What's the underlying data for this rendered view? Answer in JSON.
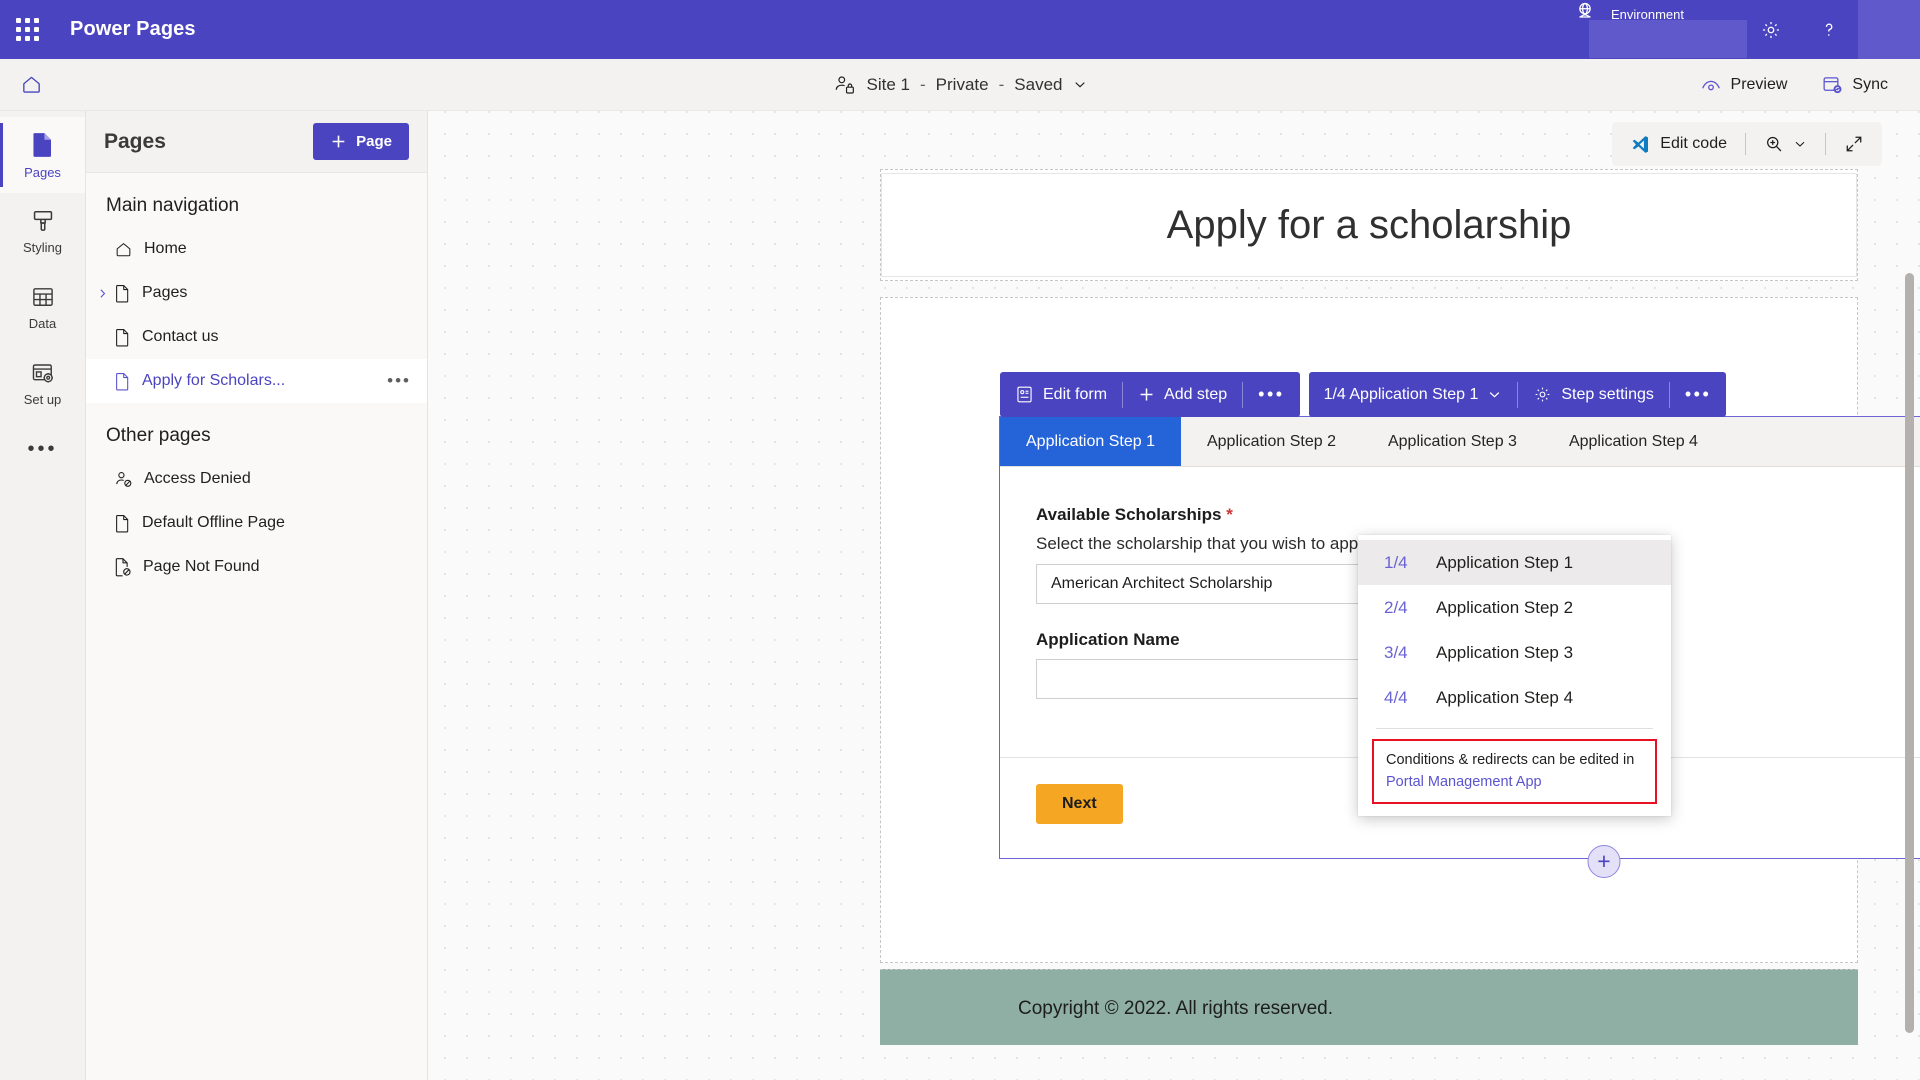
{
  "appbar": {
    "waffle_icon": "app-launcher-icon",
    "title": "Power Pages",
    "environment_label": "Environment",
    "notifications_icon": "bell-icon",
    "settings_icon": "gear-icon",
    "help_icon": "question-mark-icon"
  },
  "commandbar": {
    "home_icon": "home-icon",
    "site_name": "Site 1",
    "site_visibility": "Private",
    "site_status": "Saved",
    "site_separator": "-",
    "preview_label": "Preview",
    "sync_label": "Sync"
  },
  "rail": {
    "items": [
      {
        "label": "Pages",
        "icon": "page-icon"
      },
      {
        "label": "Styling",
        "icon": "paint-brush-icon"
      },
      {
        "label": "Data",
        "icon": "table-icon"
      },
      {
        "label": "Set up",
        "icon": "setup-icon"
      }
    ],
    "more_label": "•••"
  },
  "panel": {
    "title": "Pages",
    "new_page_label": "Page",
    "main_nav_label": "Main navigation",
    "main_nav_items": [
      {
        "label": "Home",
        "icon": "home-icon"
      },
      {
        "label": "Pages",
        "icon": "file-icon"
      },
      {
        "label": "Contact us",
        "icon": "file-icon"
      },
      {
        "label": "Apply for Scholars...",
        "icon": "file-icon"
      }
    ],
    "other_pages_label": "Other pages",
    "other_pages_items": [
      {
        "label": "Access Denied",
        "icon": "person-blocked-icon"
      },
      {
        "label": "Default Offline Page",
        "icon": "file-icon"
      },
      {
        "label": "Page Not Found",
        "icon": "file-blocked-icon"
      }
    ]
  },
  "canvas_toolbar": {
    "edit_code_label": "Edit code",
    "zoom_icon": "magnifier-plus-icon",
    "chevron_icon": "chevron-down-icon",
    "expand_icon": "expand-arrows-icon"
  },
  "page": {
    "hero_title": "Apply for a scholarship",
    "footer_text": "Copyright © 2022. All rights reserved.",
    "add_section_label": "+"
  },
  "form_toolbar": {
    "edit_form_label": "Edit form",
    "add_step_label": "Add step",
    "overflow_label": "•••",
    "step_selector_label": "1/4 Application Step 1",
    "step_settings_label": "Step settings",
    "step_overflow_label": "•••"
  },
  "form": {
    "tabs": [
      {
        "label": "Application Step 1"
      },
      {
        "label": "Application Step 2"
      },
      {
        "label": "Application Step 3"
      },
      {
        "label": "Application Step 4"
      }
    ],
    "fields": [
      {
        "label": "Available Scholarships",
        "required_marker": "*",
        "help": "Select the scholarship that you wish to apply for",
        "value": "American Architect Scholarship"
      },
      {
        "label": "Application Name",
        "required_marker": "",
        "help": "",
        "value": ""
      }
    ],
    "next_label": "Next"
  },
  "step_menu": {
    "items": [
      {
        "fraction": "1/4",
        "label": "Application Step 1"
      },
      {
        "fraction": "2/4",
        "label": "Application Step 2"
      },
      {
        "fraction": "3/4",
        "label": "Application Step 3"
      },
      {
        "fraction": "4/4",
        "label": "Application Step 4"
      }
    ],
    "note_text": "Conditions & redirects can be edited in",
    "note_link": "Portal Management App"
  },
  "colors": {
    "brand_purple": "#4b44c0",
    "active_tab_blue": "#2563d9",
    "next_button_orange": "#f5a623",
    "footer_green": "#8fafa4",
    "alert_red": "#e81123"
  }
}
